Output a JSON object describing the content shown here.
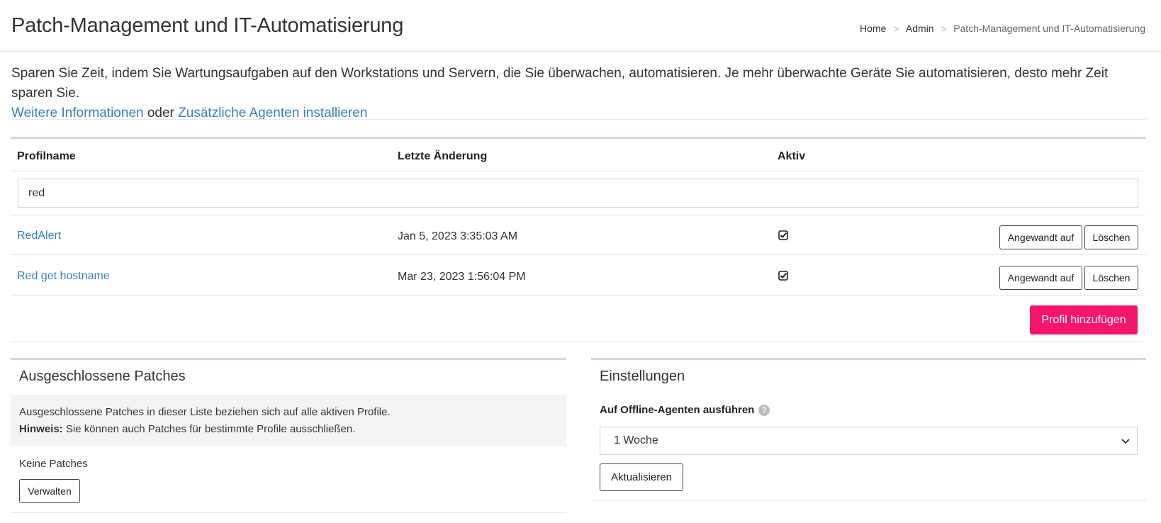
{
  "header": {
    "title": "Patch-Management und IT-Automatisierung",
    "breadcrumb": [
      {
        "label": "Home"
      },
      {
        "label": "Admin"
      },
      {
        "label": "Patch-Management und IT-Automatisierung"
      }
    ],
    "separator": ">"
  },
  "intro": {
    "text": "Sparen Sie Zeit, indem Sie Wartungsaufgaben auf den Workstations und Servern, die Sie überwachen, automatisieren. Je mehr überwachte Geräte Sie automatisieren, desto mehr Zeit sparen Sie.",
    "link1": "Weitere Informationen",
    "connector": "oder",
    "link2": "Zusätzliche Agenten installieren"
  },
  "profiles": {
    "columns": [
      "Profilname",
      "Letzte Änderung",
      "Aktiv"
    ],
    "filter_value": "red",
    "rows": [
      {
        "name": "RedAlert",
        "modified": "Jan 5, 2023 3:35:03 AM",
        "active": true,
        "applied_label": "Angewandt auf",
        "delete_label": "Löschen"
      },
      {
        "name": "Red get hostname",
        "modified": "Mar 23, 2023 1:56:04 PM",
        "active": true,
        "applied_label": "Angewandt auf",
        "delete_label": "Löschen"
      }
    ],
    "add_button": "Profil hinzufügen"
  },
  "excluded": {
    "title": "Ausgeschlossene Patches",
    "note_line1": "Ausgeschlossene Patches in dieser Liste beziehen sich auf alle aktiven Profile.",
    "note_label": "Hinweis:",
    "note_line2": "Sie können auch Patches für bestimmte Profile ausschließen.",
    "empty_text": "Keine Patches",
    "manage_button": "Verwalten"
  },
  "settings": {
    "title": "Einstellungen",
    "offline_label": "Auf Offline-Agenten ausführen",
    "help_icon": "?",
    "offline_value": "1 Woche",
    "update_button": "Aktualisieren"
  },
  "colors": {
    "link": "#3a7fb0",
    "primary": "#f5166b",
    "border": "#d2d6de"
  }
}
